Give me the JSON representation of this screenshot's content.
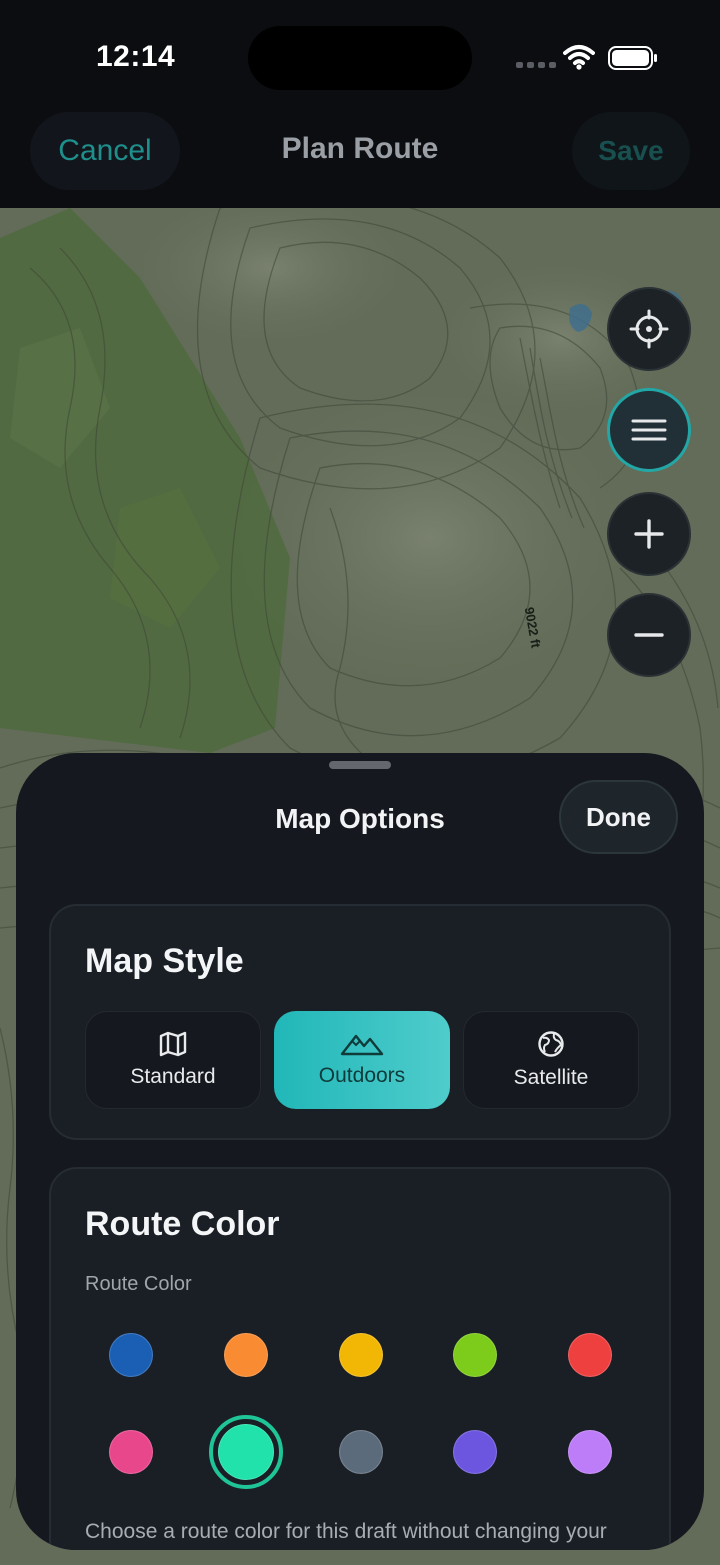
{
  "status_bar": {
    "time": "12:14"
  },
  "nav": {
    "cancel": "Cancel",
    "title": "Plan Route",
    "save": "Save"
  },
  "map": {
    "elevation_label": "9022 ft",
    "controls": [
      "locate-icon",
      "layers-icon",
      "zoom-in-icon",
      "zoom-out-icon"
    ]
  },
  "sheet": {
    "title": "Map Options",
    "done": "Done",
    "map_style": {
      "heading": "Map Style",
      "options": [
        {
          "label": "Standard",
          "icon": "map-icon"
        },
        {
          "label": "Outdoors",
          "icon": "mountains-icon"
        },
        {
          "label": "Satellite",
          "icon": "globe-icon"
        }
      ],
      "selected": "Outdoors"
    },
    "route_color": {
      "heading": "Route Color",
      "label": "Route Color",
      "colors": [
        "#1b5fb5",
        "#f98b33",
        "#f2b705",
        "#7dcb1a",
        "#ef4040",
        "#e8478c",
        "#22e2ab",
        "#5c6b7b",
        "#6c56e0",
        "#bd7df8"
      ],
      "selected_index": 6,
      "help": "Choose a route color for this draft without changing your profile default."
    }
  },
  "colors": {
    "accent": "#23b6b6",
    "sheet_bg": "#15191f",
    "card_bg": "#1a1f25"
  }
}
